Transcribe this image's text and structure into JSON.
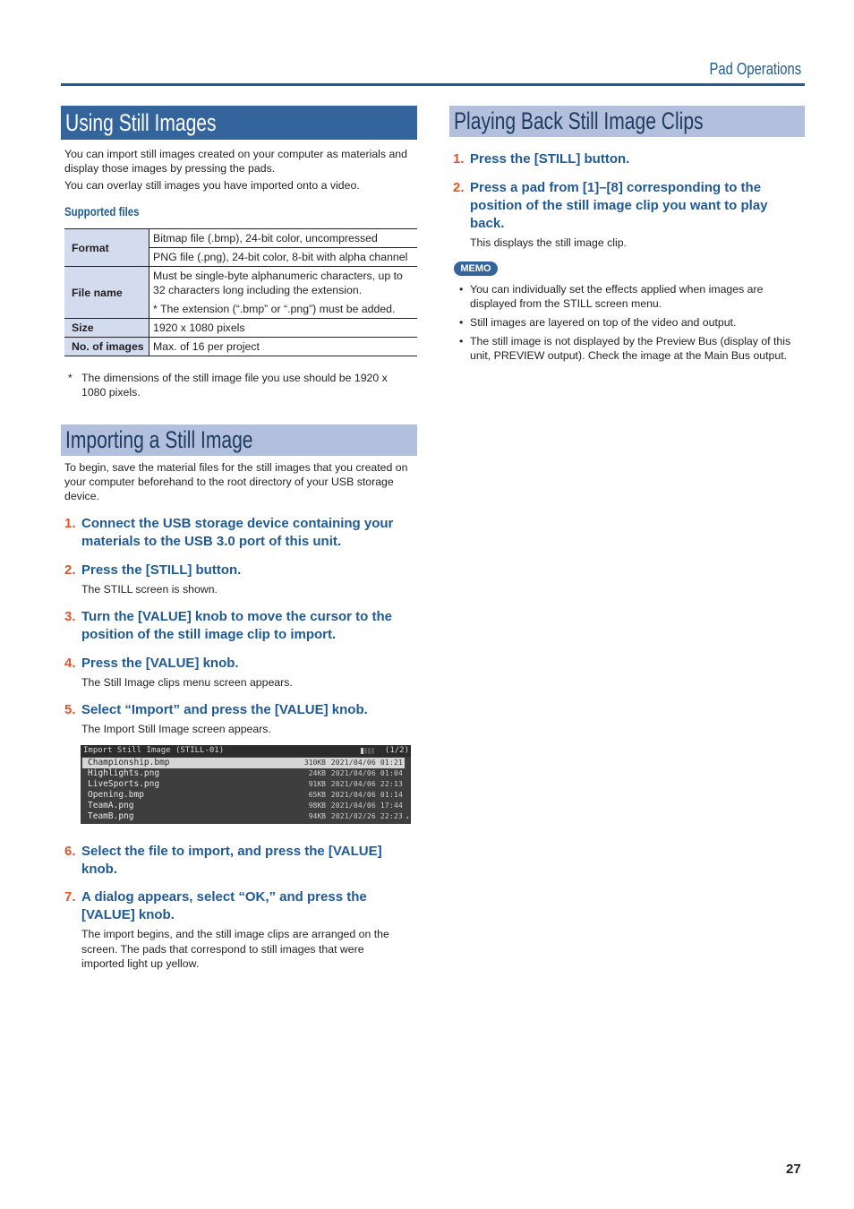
{
  "header": {
    "section_title": "Pad Operations"
  },
  "left": {
    "section1": {
      "title": "Using Still Images",
      "intro": [
        "You can import still images created on your computer as materials and display those images by pressing the pads.",
        "You can overlay still images you have imported onto a video."
      ],
      "supported_files_heading": "Supported files",
      "table": {
        "format_label": "Format",
        "format_values": [
          "Bitmap file (.bmp), 24-bit color, uncompressed",
          "PNG file (.png), 24-bit color, 8-bit with alpha channel"
        ],
        "filename_label": "File name",
        "filename_values": [
          "Must be single-byte alphanumeric characters, up to 32 characters long including the extension.",
          "* The extension (“.bmp” or “.png”) must be added."
        ],
        "size_label": "Size",
        "size_value": "1920 x 1080 pixels",
        "count_label": "No. of images",
        "count_value": "Max. of 16 per project"
      },
      "footnote_mark": "*",
      "footnote": "The dimensions of the still image file you use should be 1920 x 1080 pixels."
    },
    "section2": {
      "title": "Importing a Still Image",
      "intro": "To begin, save the material files for the still images that you created on your computer beforehand to the root directory of your USB storage device.",
      "steps": [
        {
          "num": "1.",
          "text": "Connect the USB storage device containing your materials to the USB 3.0 port of this unit.",
          "desc": ""
        },
        {
          "num": "2.",
          "text": "Press the [STILL] button.",
          "desc": "The STILL screen is shown."
        },
        {
          "num": "3.",
          "text": "Turn the [VALUE] knob to move the cursor to the position of the still image clip to import.",
          "desc": ""
        },
        {
          "num": "4.",
          "text": "Press the [VALUE] knob.",
          "desc": "The Still Image clips menu screen appears."
        },
        {
          "num": "5.",
          "text": "Select “Import” and press the [VALUE] knob.",
          "desc": "The Import Still Image screen appears."
        },
        {
          "num": "6.",
          "text": "Select the file to import, and press the [VALUE] knob.",
          "desc": ""
        },
        {
          "num": "7.",
          "text": "A dialog appears, select “OK,” and press the [VALUE] knob.",
          "desc": "The import begins, and the still image clips are arranged on the screen. The pads that correspond to still images that were imported light up yellow."
        }
      ],
      "screen": {
        "title": "Import Still Image (STILL-01)",
        "page": "(1/2)",
        "files": [
          {
            "name": "Championship.bmp",
            "size": "310KB",
            "date": "2021/04/06 01:21",
            "selected": true
          },
          {
            "name": "Highlights.png",
            "size": "24KB",
            "date": "2021/04/06 01:04"
          },
          {
            "name": "LiveSports.png",
            "size": "91KB",
            "date": "2021/04/06 22:13"
          },
          {
            "name": "Opening.bmp",
            "size": "65KB",
            "date": "2021/04/06 01:14"
          },
          {
            "name": "TeamA.png",
            "size": "98KB",
            "date": "2021/04/06 17:44"
          },
          {
            "name": "TeamB.png",
            "size": "94KB",
            "date": "2021/02/26 22:23"
          }
        ],
        "scroll_arrow": "▾"
      }
    }
  },
  "right": {
    "section": {
      "title": "Playing Back Still Image Clips",
      "steps": [
        {
          "num": "1.",
          "text": "Press the [STILL] button.",
          "desc": ""
        },
        {
          "num": "2.",
          "text": "Press a pad from [1]–[8] corresponding to the position of the still image clip you want to play back.",
          "desc": "This displays the still image clip."
        }
      ],
      "memo_label": "MEMO",
      "memo_items": [
        "You can individually set the effects applied when images are displayed from the STILL screen menu.",
        "Still images are layered on top of the video and output.",
        "The still image is not displayed by the Preview Bus (display of this unit, PREVIEW output). Check the image at the Main Bus output."
      ],
      "bullet": "•"
    }
  },
  "footer": {
    "page_number": "27"
  }
}
